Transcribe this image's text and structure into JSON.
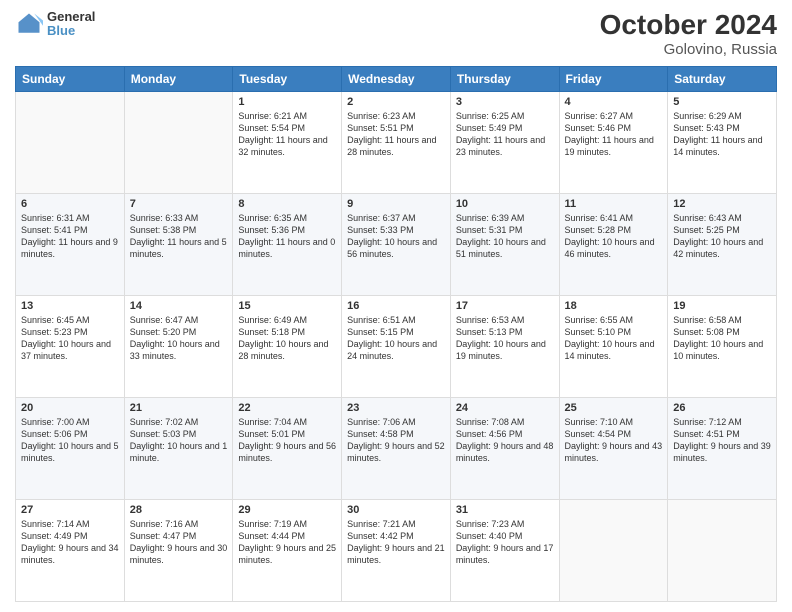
{
  "header": {
    "logo_line1": "General",
    "logo_line2": "Blue",
    "title": "October 2024",
    "subtitle": "Golovino, Russia"
  },
  "weekdays": [
    "Sunday",
    "Monday",
    "Tuesday",
    "Wednesday",
    "Thursday",
    "Friday",
    "Saturday"
  ],
  "weeks": [
    [
      {
        "day": "",
        "sunrise": "",
        "sunset": "",
        "daylight": ""
      },
      {
        "day": "",
        "sunrise": "",
        "sunset": "",
        "daylight": ""
      },
      {
        "day": "1",
        "sunrise": "Sunrise: 6:21 AM",
        "sunset": "Sunset: 5:54 PM",
        "daylight": "Daylight: 11 hours and 32 minutes."
      },
      {
        "day": "2",
        "sunrise": "Sunrise: 6:23 AM",
        "sunset": "Sunset: 5:51 PM",
        "daylight": "Daylight: 11 hours and 28 minutes."
      },
      {
        "day": "3",
        "sunrise": "Sunrise: 6:25 AM",
        "sunset": "Sunset: 5:49 PM",
        "daylight": "Daylight: 11 hours and 23 minutes."
      },
      {
        "day": "4",
        "sunrise": "Sunrise: 6:27 AM",
        "sunset": "Sunset: 5:46 PM",
        "daylight": "Daylight: 11 hours and 19 minutes."
      },
      {
        "day": "5",
        "sunrise": "Sunrise: 6:29 AM",
        "sunset": "Sunset: 5:43 PM",
        "daylight": "Daylight: 11 hours and 14 minutes."
      }
    ],
    [
      {
        "day": "6",
        "sunrise": "Sunrise: 6:31 AM",
        "sunset": "Sunset: 5:41 PM",
        "daylight": "Daylight: 11 hours and 9 minutes."
      },
      {
        "day": "7",
        "sunrise": "Sunrise: 6:33 AM",
        "sunset": "Sunset: 5:38 PM",
        "daylight": "Daylight: 11 hours and 5 minutes."
      },
      {
        "day": "8",
        "sunrise": "Sunrise: 6:35 AM",
        "sunset": "Sunset: 5:36 PM",
        "daylight": "Daylight: 11 hours and 0 minutes."
      },
      {
        "day": "9",
        "sunrise": "Sunrise: 6:37 AM",
        "sunset": "Sunset: 5:33 PM",
        "daylight": "Daylight: 10 hours and 56 minutes."
      },
      {
        "day": "10",
        "sunrise": "Sunrise: 6:39 AM",
        "sunset": "Sunset: 5:31 PM",
        "daylight": "Daylight: 10 hours and 51 minutes."
      },
      {
        "day": "11",
        "sunrise": "Sunrise: 6:41 AM",
        "sunset": "Sunset: 5:28 PM",
        "daylight": "Daylight: 10 hours and 46 minutes."
      },
      {
        "day": "12",
        "sunrise": "Sunrise: 6:43 AM",
        "sunset": "Sunset: 5:25 PM",
        "daylight": "Daylight: 10 hours and 42 minutes."
      }
    ],
    [
      {
        "day": "13",
        "sunrise": "Sunrise: 6:45 AM",
        "sunset": "Sunset: 5:23 PM",
        "daylight": "Daylight: 10 hours and 37 minutes."
      },
      {
        "day": "14",
        "sunrise": "Sunrise: 6:47 AM",
        "sunset": "Sunset: 5:20 PM",
        "daylight": "Daylight: 10 hours and 33 minutes."
      },
      {
        "day": "15",
        "sunrise": "Sunrise: 6:49 AM",
        "sunset": "Sunset: 5:18 PM",
        "daylight": "Daylight: 10 hours and 28 minutes."
      },
      {
        "day": "16",
        "sunrise": "Sunrise: 6:51 AM",
        "sunset": "Sunset: 5:15 PM",
        "daylight": "Daylight: 10 hours and 24 minutes."
      },
      {
        "day": "17",
        "sunrise": "Sunrise: 6:53 AM",
        "sunset": "Sunset: 5:13 PM",
        "daylight": "Daylight: 10 hours and 19 minutes."
      },
      {
        "day": "18",
        "sunrise": "Sunrise: 6:55 AM",
        "sunset": "Sunset: 5:10 PM",
        "daylight": "Daylight: 10 hours and 14 minutes."
      },
      {
        "day": "19",
        "sunrise": "Sunrise: 6:58 AM",
        "sunset": "Sunset: 5:08 PM",
        "daylight": "Daylight: 10 hours and 10 minutes."
      }
    ],
    [
      {
        "day": "20",
        "sunrise": "Sunrise: 7:00 AM",
        "sunset": "Sunset: 5:06 PM",
        "daylight": "Daylight: 10 hours and 5 minutes."
      },
      {
        "day": "21",
        "sunrise": "Sunrise: 7:02 AM",
        "sunset": "Sunset: 5:03 PM",
        "daylight": "Daylight: 10 hours and 1 minute."
      },
      {
        "day": "22",
        "sunrise": "Sunrise: 7:04 AM",
        "sunset": "Sunset: 5:01 PM",
        "daylight": "Daylight: 9 hours and 56 minutes."
      },
      {
        "day": "23",
        "sunrise": "Sunrise: 7:06 AM",
        "sunset": "Sunset: 4:58 PM",
        "daylight": "Daylight: 9 hours and 52 minutes."
      },
      {
        "day": "24",
        "sunrise": "Sunrise: 7:08 AM",
        "sunset": "Sunset: 4:56 PM",
        "daylight": "Daylight: 9 hours and 48 minutes."
      },
      {
        "day": "25",
        "sunrise": "Sunrise: 7:10 AM",
        "sunset": "Sunset: 4:54 PM",
        "daylight": "Daylight: 9 hours and 43 minutes."
      },
      {
        "day": "26",
        "sunrise": "Sunrise: 7:12 AM",
        "sunset": "Sunset: 4:51 PM",
        "daylight": "Daylight: 9 hours and 39 minutes."
      }
    ],
    [
      {
        "day": "27",
        "sunrise": "Sunrise: 7:14 AM",
        "sunset": "Sunset: 4:49 PM",
        "daylight": "Daylight: 9 hours and 34 minutes."
      },
      {
        "day": "28",
        "sunrise": "Sunrise: 7:16 AM",
        "sunset": "Sunset: 4:47 PM",
        "daylight": "Daylight: 9 hours and 30 minutes."
      },
      {
        "day": "29",
        "sunrise": "Sunrise: 7:19 AM",
        "sunset": "Sunset: 4:44 PM",
        "daylight": "Daylight: 9 hours and 25 minutes."
      },
      {
        "day": "30",
        "sunrise": "Sunrise: 7:21 AM",
        "sunset": "Sunset: 4:42 PM",
        "daylight": "Daylight: 9 hours and 21 minutes."
      },
      {
        "day": "31",
        "sunrise": "Sunrise: 7:23 AM",
        "sunset": "Sunset: 4:40 PM",
        "daylight": "Daylight: 9 hours and 17 minutes."
      },
      {
        "day": "",
        "sunrise": "",
        "sunset": "",
        "daylight": ""
      },
      {
        "day": "",
        "sunrise": "",
        "sunset": "",
        "daylight": ""
      }
    ]
  ]
}
